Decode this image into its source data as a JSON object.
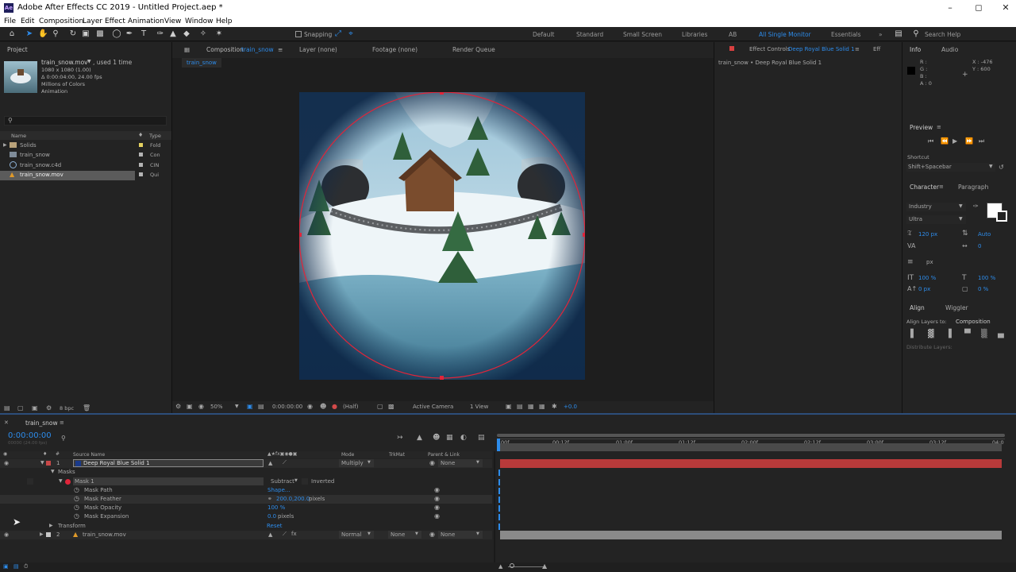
{
  "title": "Adobe After Effects CC 2019 - Untitled Project.aep *",
  "menu": [
    "File",
    "Edit",
    "Composition",
    "Layer",
    "Effect",
    "Animation",
    "View",
    "Window",
    "Help"
  ],
  "toolbar": {
    "snapping": "Snapping",
    "workspaces": [
      "Default",
      "Standard",
      "Small Screen",
      "Libraries",
      "AB",
      "All Single Monitor",
      "Essentials"
    ],
    "active_workspace": "All Single Monitor",
    "search": "Search Help"
  },
  "project": {
    "tab": "Project",
    "item_name": "train_snow.mov",
    "used": ", used 1 time",
    "lines": [
      "1080 x 1080 (1.00)",
      "Δ 0:00:04:00, 24.00 fps",
      "Millions of Colors",
      "Animation"
    ],
    "col_name": "Name",
    "col_type": "Type",
    "items": [
      {
        "name": "Solids",
        "type": "Fold"
      },
      {
        "name": "train_snow",
        "type": "Con"
      },
      {
        "name": "train_snow.c4d",
        "type": "CIN"
      },
      {
        "name": "train_snow.mov",
        "type": "Qui"
      }
    ],
    "bpc": "8 bpc"
  },
  "viewer": {
    "comp_label": "Composition",
    "comp_name": "train_snow",
    "layer_tab": "Layer (none)",
    "footage_tab": "Footage (none)",
    "render_tab": "Render Queue",
    "sub_tab": "train_snow",
    "zoom": "50%",
    "timecode": "0:00:00:00",
    "res": "(Half)",
    "camera": "Active Camera",
    "views": "1 View",
    "exposure": "+0.0"
  },
  "effects": {
    "label": "Effect Controls",
    "layer": "Deep Royal Blue Solid 1",
    "breadcrumb": "train_snow • Deep Royal Blue Solid 1"
  },
  "info": {
    "tab": "Info",
    "audio": "Audio",
    "r": "R :",
    "g": "G :",
    "b": "B :",
    "a": "A : 0",
    "x": "X : -476",
    "y": "Y : 600"
  },
  "preview": {
    "tab": "Preview",
    "shortcut_label": "Shortcut",
    "shortcut": "Shift+Spacebar"
  },
  "character": {
    "tab": "Character",
    "paragraph": "Paragraph",
    "font": "Industry",
    "style": "Ultra",
    "size": "120 px",
    "leading": "Auto",
    "tracking": "0",
    "stroke": "px",
    "vscale": "100 %",
    "hscale": "100 %",
    "baseline": "0 px",
    "tsume": "0 %"
  },
  "align": {
    "tab": "Align",
    "wiggler": "Wiggler",
    "align_to_label": "Align Layers to:",
    "align_to": "Composition",
    "distribute": "Distribute Layers:"
  },
  "timeline": {
    "tab": "train_snow",
    "timecode": "0:00:00:00",
    "frames": "00000 (24.00 fps)",
    "col_source": "Source Name",
    "col_mode": "Mode",
    "col_trkmat": "TrkMat",
    "col_parent": "Parent & Link",
    "ruler": [
      "00f",
      "00:12f",
      "01:00f",
      "01:12f",
      "02:00f",
      "02:12f",
      "03:00f",
      "03:12f",
      "04:0"
    ],
    "layer1": {
      "num": "1",
      "name": "Deep Royal Blue Solid 1",
      "mode": "Multiply",
      "parent": "None"
    },
    "masks": "Masks",
    "mask1": "Mask 1",
    "mask_mode": "Subtract",
    "inverted": "Inverted",
    "mask_path": "Mask Path",
    "mask_path_val": "Shape...",
    "mask_feather": "Mask Feather",
    "mask_feather_val": "200.0,200.0",
    "pixels": "pixels",
    "mask_opacity": "Mask Opacity",
    "mask_opacity_val": "100 %",
    "mask_expansion": "Mask Expansion",
    "mask_expansion_val": "0.0",
    "pixels2": "pixels",
    "transform": "Transform",
    "reset": "Reset",
    "layer2": {
      "num": "2",
      "name": "train_snow.mov",
      "mode": "Normal",
      "trkmat": "None",
      "parent": "None"
    }
  },
  "colors": {
    "accent": "#2d8ceb",
    "layer_red": "#b83a3a",
    "mask_red": "#e0253a"
  }
}
